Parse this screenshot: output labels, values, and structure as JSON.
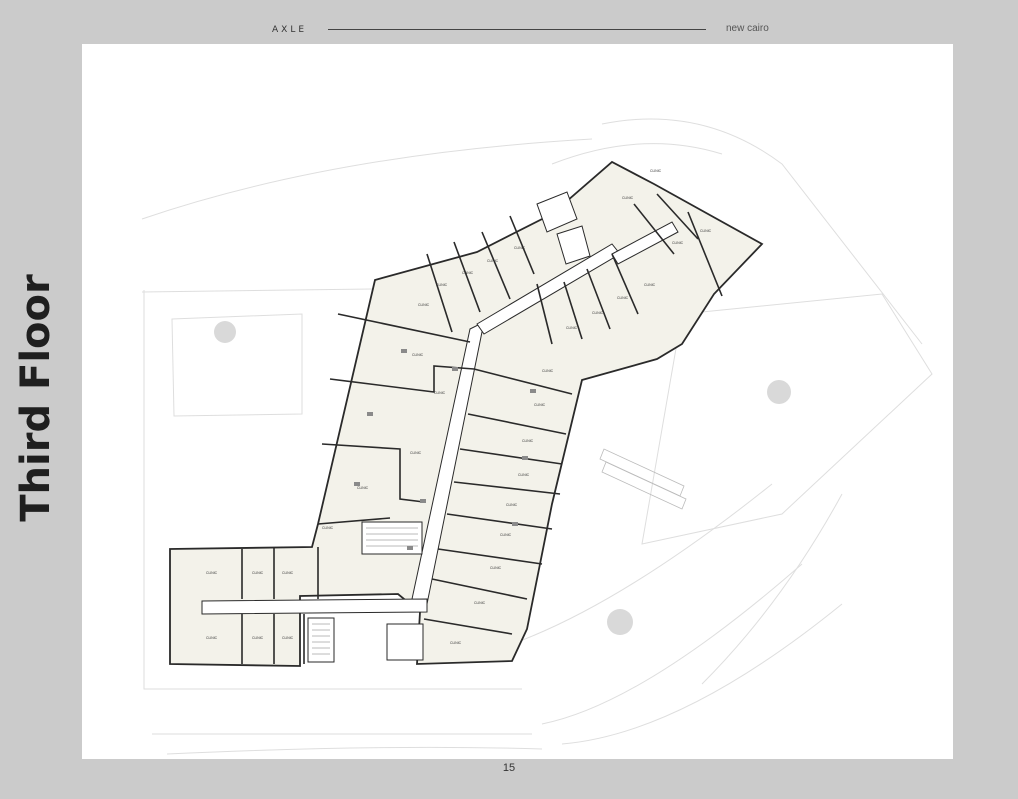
{
  "header": {
    "brand": "AXLE",
    "location": "new cairo"
  },
  "page": {
    "title": "Third Floor",
    "number": "15"
  },
  "plan": {
    "unit_type": "CLINIC",
    "colors": {
      "unit_fill": "#f3f2ea",
      "wall": "#2a2a2a",
      "context_lines": "#dcdcdc"
    }
  }
}
